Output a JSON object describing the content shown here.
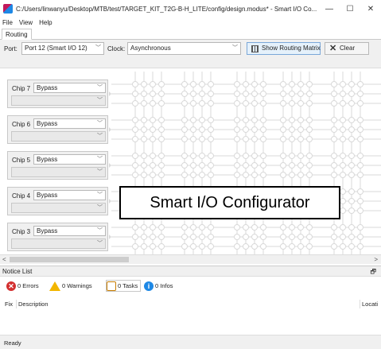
{
  "window": {
    "title": "C:/Users/linwanyu/Desktop/MTB/test/TARGET_KIT_T2G-B-H_LITE/config/design.modus* - Smart I/O Co...",
    "minimize": "—",
    "maximize": "☐",
    "close": "✕",
    "icon": "app-icon"
  },
  "menu": [
    "File",
    "View",
    "Help"
  ],
  "tabs": [
    "Routing"
  ],
  "toolbar": {
    "port_label": "Port:",
    "port_value": "Port 12 (Smart I/O 12)",
    "clock_label": "Clock:",
    "clock_value": "Asynchronous",
    "routing_matrix_label": "Show Routing Matrix",
    "clear_label": "Clear"
  },
  "chips": [
    {
      "label": "Chip 7",
      "mode": "Bypass"
    },
    {
      "label": "Chip 6",
      "mode": "Bypass"
    },
    {
      "label": "Chip 5",
      "mode": "Bypass"
    },
    {
      "label": "Chip 4",
      "mode": "Bypass"
    },
    {
      "label": "Chip 3",
      "mode": "Bypass"
    }
  ],
  "overlay_text": "Smart I/O Configurator",
  "notice": {
    "title": "Notice List",
    "errors": "0 Errors",
    "warnings": "0 Warnings",
    "tasks": "0 Tasks",
    "infos": "0 Infos",
    "col_fix": "Fix",
    "col_description": "Description",
    "col_location": "Locati"
  },
  "status": "Ready",
  "colors": {
    "error": "#d32f2f",
    "warning": "#f2b600",
    "info": "#1e88e5",
    "highlight": "#e5f1fb"
  }
}
